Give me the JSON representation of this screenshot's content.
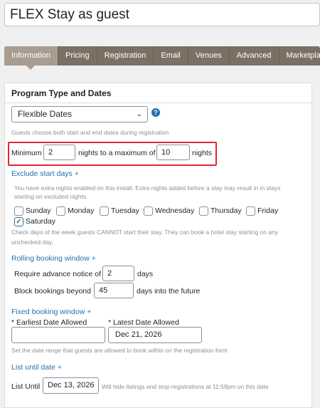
{
  "page_title": "FLEX Stay as guest",
  "tabs": [
    {
      "label": "Information"
    },
    {
      "label": "Pricing"
    },
    {
      "label": "Registration"
    },
    {
      "label": "Email"
    },
    {
      "label": "Venues"
    },
    {
      "label": "Advanced"
    },
    {
      "label": "Marketplace"
    }
  ],
  "panel": {
    "title": "Program Type and Dates",
    "program_type": {
      "value": "Flexible Dates",
      "hint": "Guests choose both start and end dates during registration"
    },
    "nights": {
      "prefix": "Minimum",
      "min": "2",
      "middle": "nights to a maximum of",
      "max": "10",
      "suffix": "nights"
    },
    "exclude": {
      "link": "Exclude start days +",
      "notice": "You have extra nights enabled on this install. Extra nights added before a stay may result in in stays",
      "notice2": "starting on excluded nights.",
      "days": [
        {
          "label": "Sunday",
          "checked": false
        },
        {
          "label": "Monday",
          "checked": false
        },
        {
          "label": "Tuesday",
          "checked": false
        },
        {
          "label": "Wednesday",
          "checked": false
        },
        {
          "label": "Thursday",
          "checked": false
        },
        {
          "label": "Friday",
          "checked": false
        },
        {
          "label": "Saturday",
          "checked": true
        }
      ],
      "hint1": "Check days of the week guests CANNOT start their stay. They can book a hotel stay starting on any",
      "hint2": "unchecked day."
    },
    "rolling": {
      "link": "Rolling booking window +",
      "advance_label": "Require advance notice of",
      "advance_value": "2",
      "advance_suffix": "days",
      "block_label": "Block bookings beyond",
      "block_value": "45",
      "block_suffix": "days into the future"
    },
    "fixed": {
      "link": "Fixed booking window +",
      "earliest_label": "* Earliest Date Allowed",
      "earliest_value": "",
      "latest_label": "* Latest Date Allowed",
      "latest_value": "Dec 21, 2026",
      "hint": "Set the date range that guests are allowed to book within on the registration form"
    },
    "list_until": {
      "link": "List until date +",
      "label": "List Until",
      "value": "Dec 13, 2026",
      "hint": "Will hide listings and stop registrations at 11:59pm on this date"
    }
  }
}
